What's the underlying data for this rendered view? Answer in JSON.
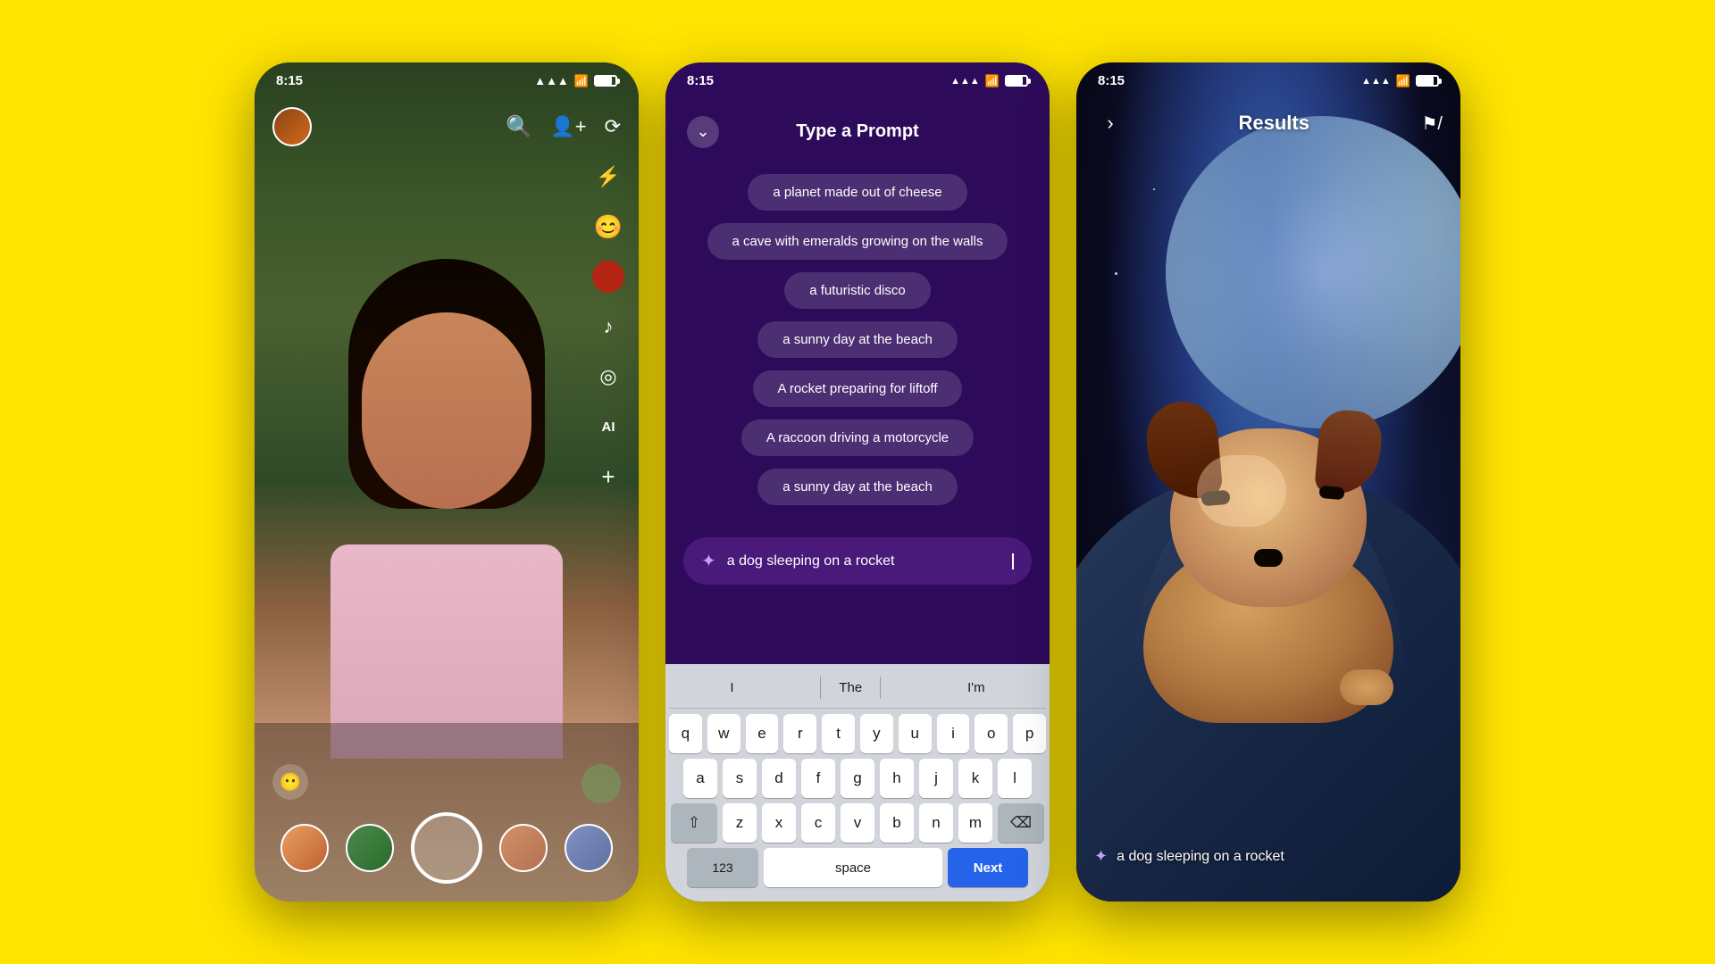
{
  "background_color": "#FFE400",
  "phones": {
    "phone1": {
      "status": {
        "time": "8:15",
        "signal": "signal",
        "wifi": "wifi",
        "battery": "battery"
      },
      "camera": {
        "icons": [
          "search",
          "add-friend",
          "flip-camera"
        ],
        "right_icons": [
          "flash",
          "effects",
          "record",
          "music",
          "lens",
          "ai",
          "add"
        ],
        "bottom": {
          "left_icon": "face-effects",
          "right_icon": "bitmoji",
          "thumbnails": [
            "thumb1",
            "thumb2",
            "thumb3",
            "thumb4"
          ],
          "shutter": "shutter"
        }
      }
    },
    "phone2": {
      "status": {
        "time": "8:15"
      },
      "header": {
        "back_label": "‹",
        "title": "Type a Prompt"
      },
      "suggestions": [
        "a planet made out of cheese",
        "a cave with emeralds growing on the walls",
        "a futuristic disco",
        "a sunny day at the beach",
        "A rocket preparing for liftoff",
        "A raccoon driving a motorcycle",
        "a sunny day at the beach"
      ],
      "input": {
        "placeholder": "a dog sleeping on a rocket",
        "value": "a dog sleeping on a rocket"
      },
      "keyboard": {
        "word_suggestions": [
          "I",
          "The",
          "I'm"
        ],
        "rows": [
          [
            "q",
            "w",
            "e",
            "r",
            "t",
            "y",
            "u",
            "i",
            "o",
            "p"
          ],
          [
            "a",
            "s",
            "d",
            "f",
            "g",
            "h",
            "j",
            "k",
            "l"
          ],
          [
            "⇧",
            "z",
            "x",
            "c",
            "v",
            "b",
            "n",
            "m",
            "⌫"
          ],
          [
            "123",
            "space",
            "Next"
          ]
        ]
      }
    },
    "phone3": {
      "status": {
        "time": "8:15"
      },
      "header": {
        "back_label": "›",
        "title": "Results",
        "flag": "⚑"
      },
      "caption": "a dog sleeping on a rocket",
      "image_description": "AI generated image of a cute dog sleeping on a rocket in space"
    }
  }
}
